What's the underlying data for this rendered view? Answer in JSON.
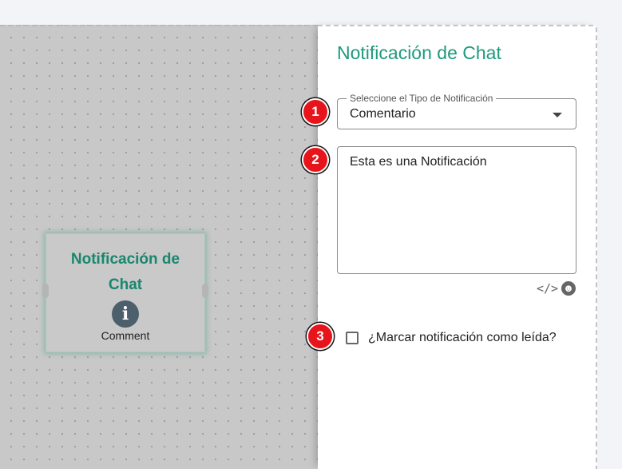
{
  "canvas": {
    "node": {
      "title": "Notificación de Chat",
      "icon": "info-icon",
      "icon_glyph": "i",
      "label": "Comment"
    }
  },
  "panel": {
    "title": "Notificación de Chat",
    "select": {
      "legend": "Seleccione el Tipo de Notificación",
      "value": "Comentario"
    },
    "message": {
      "value": "Esta es una Notificación"
    },
    "tools": {
      "code_icon": "code-icon",
      "code_glyph": "</>",
      "emoji_icon": "emoji-icon",
      "emoji_glyph": "☻"
    },
    "checkbox": {
      "label": "¿Marcar notificación como leída?",
      "checked": false
    }
  },
  "markers": [
    "1",
    "2",
    "3"
  ],
  "colors": {
    "accent": "#1e9a7d",
    "node_title": "#17876d",
    "marker": "#e8141b"
  }
}
